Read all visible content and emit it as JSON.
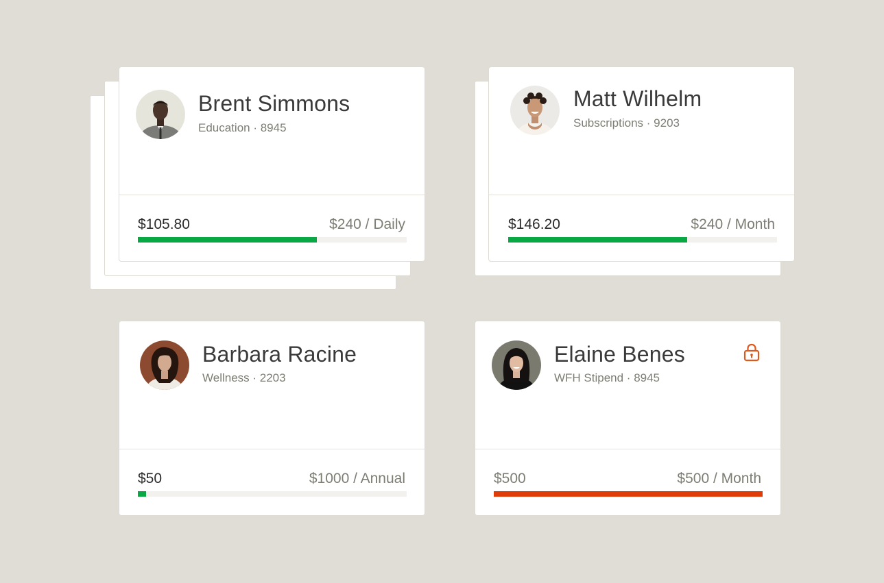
{
  "colors": {
    "background": "#e0ddd7",
    "progress_green": "#0aa845",
    "progress_red": "#e03c0a",
    "lock_orange": "#dd5a1e"
  },
  "cards": [
    {
      "name": "Brent Simmons",
      "subtitle": "Education · 8945",
      "spent": "$105.80",
      "limit": "$240 / Daily",
      "progress": 0.665,
      "progress_color": "green",
      "locked": false
    },
    {
      "name": "Matt Wilhelm",
      "subtitle": "Subscriptions · 9203",
      "spent": "$146.20",
      "limit": "$240 / Month",
      "progress": 0.665,
      "progress_color": "green",
      "locked": false
    },
    {
      "name": "Barbara Racine",
      "subtitle": "Wellness · 2203",
      "spent": "$50",
      "limit": "$1000 / Annual",
      "progress": 0.03,
      "progress_color": "green",
      "locked": false
    },
    {
      "name": "Elaine Benes",
      "subtitle": "WFH Stipend · 8945",
      "spent": "$500",
      "limit": "$500 / Month",
      "progress": 1.0,
      "progress_color": "red",
      "locked": true,
      "lock_icon": "lock-icon"
    }
  ]
}
